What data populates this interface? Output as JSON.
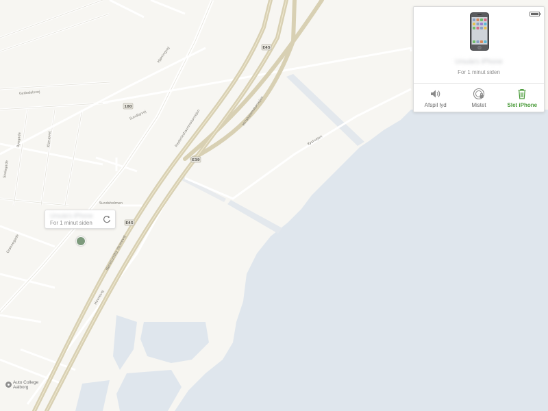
{
  "map": {
    "road_labels": [
      "Hjørringvej",
      "Gydedalsvej",
      "Vestre Havnepromenade",
      "Nørresundby Havnevej",
      "Frederikshavnmotorvejen",
      "Hirtshalsmotorvejen",
      "Kystvejen",
      "Sundsholmen",
      "Ryegade",
      "Klarupvej",
      "Sundbyvej",
      "Skolegade",
      "Grønnegade",
      "Havnevej"
    ],
    "shields": [
      "E45",
      "E39",
      "E45",
      "180"
    ],
    "poi": {
      "name": "Auto College Aalborg",
      "icon": "place-marker-icon"
    }
  },
  "device_popup": {
    "name": "Ursula's iPhone",
    "time": "For 1 minut siden",
    "refresh_icon": "refresh-icon"
  },
  "device_panel": {
    "device_name": "Ursula's iPhone",
    "time": "For 1 minut siden",
    "battery_icon": "battery-icon",
    "actions": [
      {
        "label": "Afspil lyd",
        "icon": "speaker-icon",
        "color": "#6a6a6a"
      },
      {
        "label": "Mistet",
        "icon": "lost-mode-icon",
        "color": "#6a6a6a"
      },
      {
        "label": "Slet iPhone",
        "icon": "trash-icon",
        "color": "#4a9b3a"
      }
    ]
  },
  "colors": {
    "water": "#dfe6ed",
    "land": "#f7f6f2",
    "highway": "#d8d0b3",
    "accent_green": "#4a9b3a"
  }
}
